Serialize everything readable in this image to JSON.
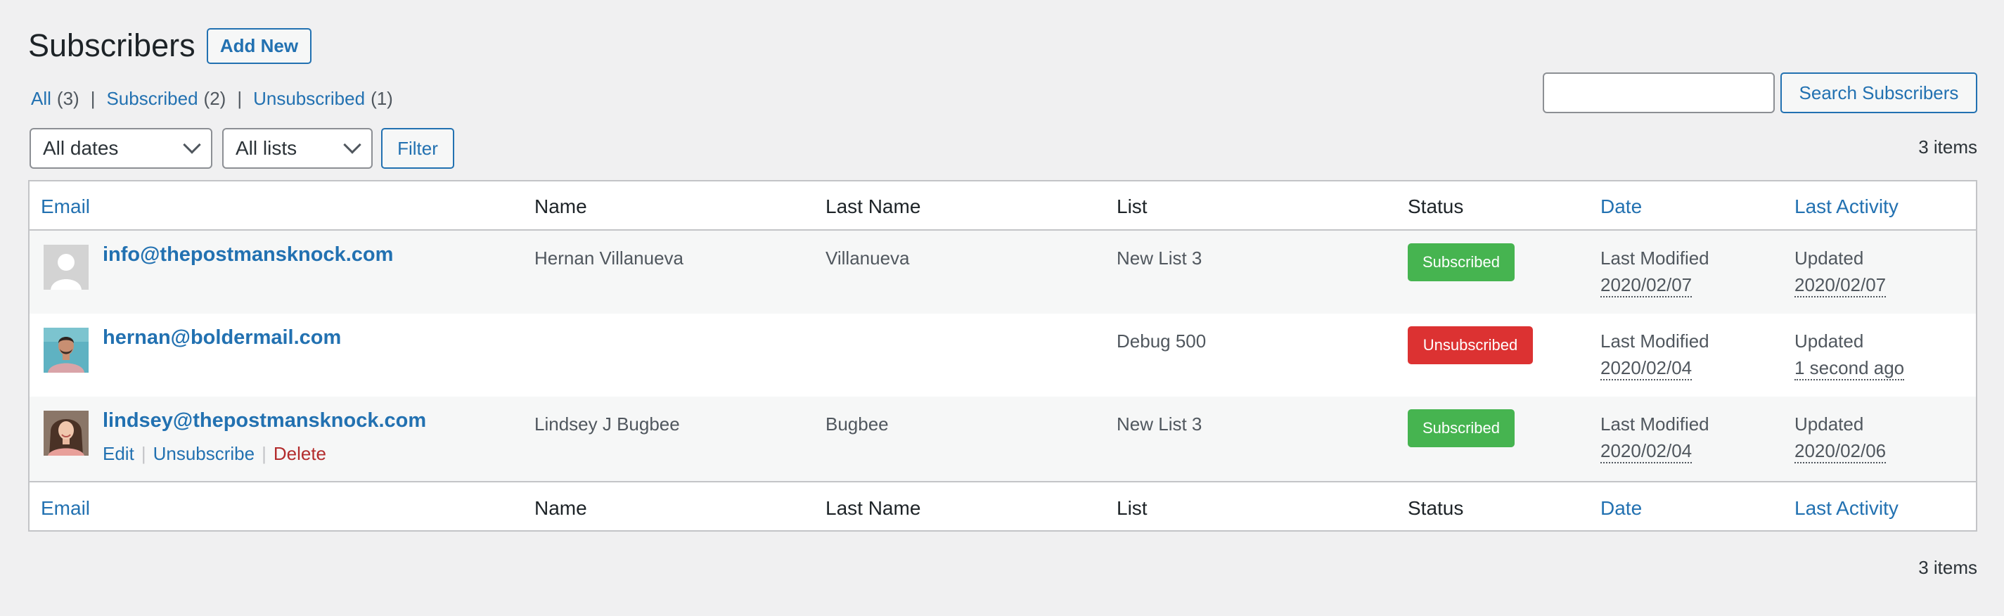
{
  "header": {
    "title": "Subscribers",
    "add_new": "Add New"
  },
  "views": [
    {
      "label": "All",
      "count": "(3)"
    },
    {
      "label": "Subscribed",
      "count": "(2)"
    },
    {
      "label": "Unsubscribed",
      "count": "(1)"
    }
  ],
  "views_separator": "|",
  "search": {
    "value": "",
    "button": "Search Subscribers"
  },
  "filters": {
    "dates": "All dates",
    "lists": "All lists",
    "button": "Filter"
  },
  "items_count": "3 items",
  "columns": {
    "email": "Email",
    "name": "Name",
    "last_name": "Last Name",
    "list": "List",
    "status": "Status",
    "date": "Date",
    "last_activity": "Last Activity"
  },
  "rows": [
    {
      "email": "info@thepostmansknock.com",
      "name": "Hernan Villanueva",
      "last_name": "Villanueva",
      "list": "New List 3",
      "status": "Subscribed",
      "date_label": "Last Modified",
      "date": "2020/02/07",
      "activity_label": "Updated",
      "activity": "2020/02/07",
      "avatar": "default-person-icon"
    },
    {
      "email": "hernan@boldermail.com",
      "name": "",
      "last_name": "",
      "list": "Debug 500",
      "status": "Unsubscribed",
      "date_label": "Last Modified",
      "date": "2020/02/04",
      "activity_label": "Updated",
      "activity": "1 second ago",
      "avatar": "man-photo"
    },
    {
      "email": "lindsey@thepostmansknock.com",
      "name": "Lindsey J Bugbee",
      "last_name": "Bugbee",
      "list": "New List 3",
      "status": "Subscribed",
      "date_label": "Last Modified",
      "date": "2020/02/04",
      "activity_label": "Updated",
      "activity": "2020/02/06",
      "avatar": "woman-photo",
      "actions": {
        "edit": "Edit",
        "unsubscribe": "Unsubscribe",
        "delete": "Delete"
      }
    }
  ],
  "colors": {
    "link": "#2271b1",
    "subscribed": "#46b450",
    "unsubscribed": "#dc3232",
    "delete": "#b32d2e"
  }
}
